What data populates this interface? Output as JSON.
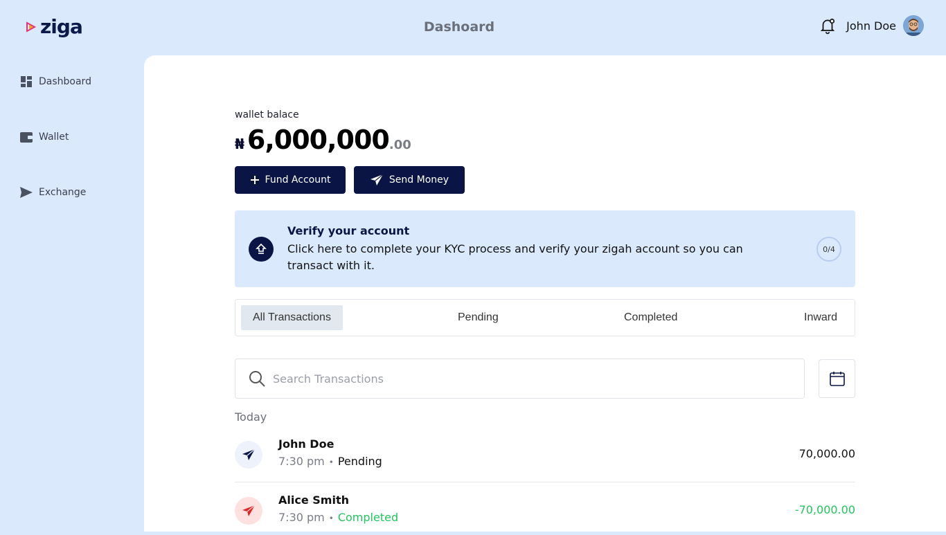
{
  "brand": {
    "name": "ziga"
  },
  "header": {
    "title": "Dashoard",
    "user_name": "John Doe"
  },
  "sidebar": {
    "items": [
      {
        "label": "Dashboard",
        "icon": "dashboard-icon"
      },
      {
        "label": "Wallet",
        "icon": "wallet-icon"
      },
      {
        "label": "Exchange",
        "icon": "send-icon"
      }
    ]
  },
  "wallet": {
    "label": "wallet balace",
    "currency_symbol": "₦",
    "amount": "6,000,000",
    "decimals": ".00"
  },
  "actions": {
    "fund_label": "Fund Account",
    "send_label": "Send Money"
  },
  "verify": {
    "title": "Verify your account",
    "text": "Click here to complete your KYC process and verify your zigah account so you can transact with it.",
    "progress": "0/4"
  },
  "tabs": [
    "All Transactions",
    "Pending",
    "Completed",
    "Inward"
  ],
  "search": {
    "placeholder": "Search Transactions"
  },
  "transactions": {
    "group_label": "Today",
    "items": [
      {
        "name": "John Doe",
        "time": "7:30 pm",
        "status": "Pending",
        "amount": "70,000.00"
      },
      {
        "name": "Alice Smith",
        "time": "7:30 pm",
        "status": "Completed",
        "amount": "-70,000.00"
      }
    ]
  },
  "colors": {
    "background": "#dbe9fd",
    "primary": "#0b1545",
    "completed": "#22c55e",
    "outgoing_icon_bg": "#fde0e0",
    "incoming_icon_bg": "#eef2fb"
  }
}
